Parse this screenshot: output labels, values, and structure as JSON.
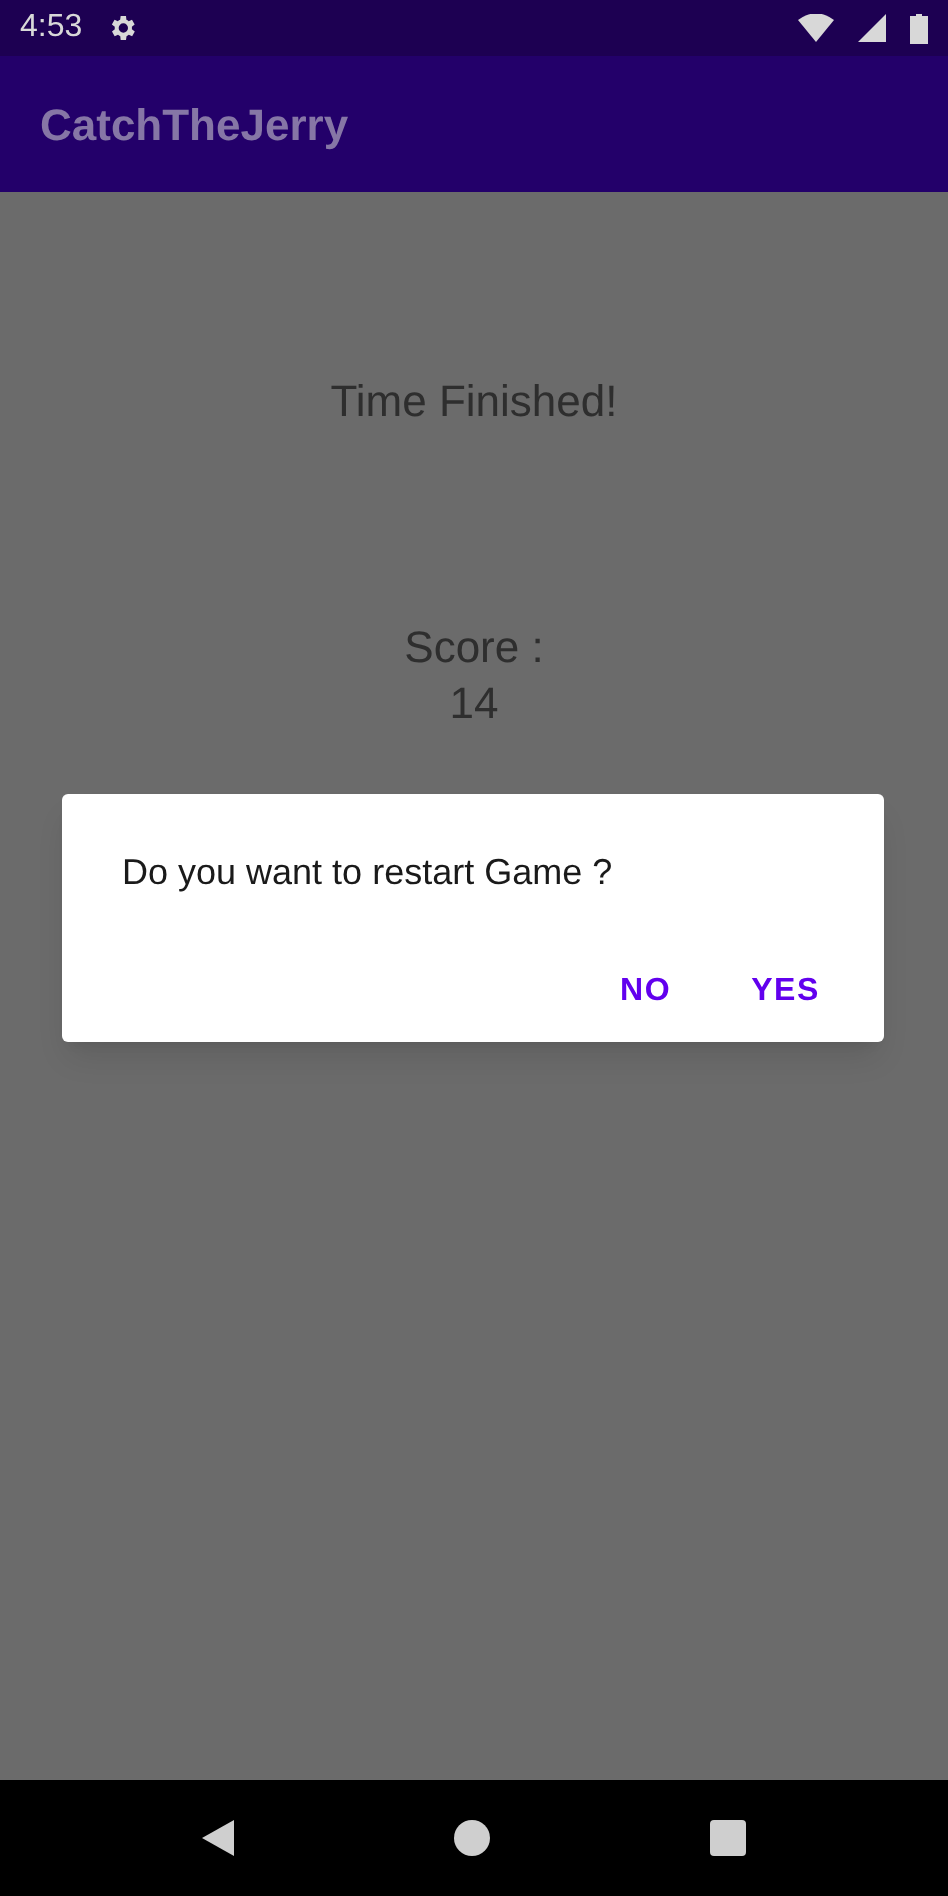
{
  "status_bar": {
    "time": "4:53"
  },
  "app_bar": {
    "title": "CatchTheJerry"
  },
  "content": {
    "heading": "Time Finished!",
    "score_label": "Score :",
    "score_value": "14"
  },
  "dialog": {
    "message": "Do you want to restart Game ?",
    "buttons": [
      "NO",
      "YES"
    ]
  }
}
